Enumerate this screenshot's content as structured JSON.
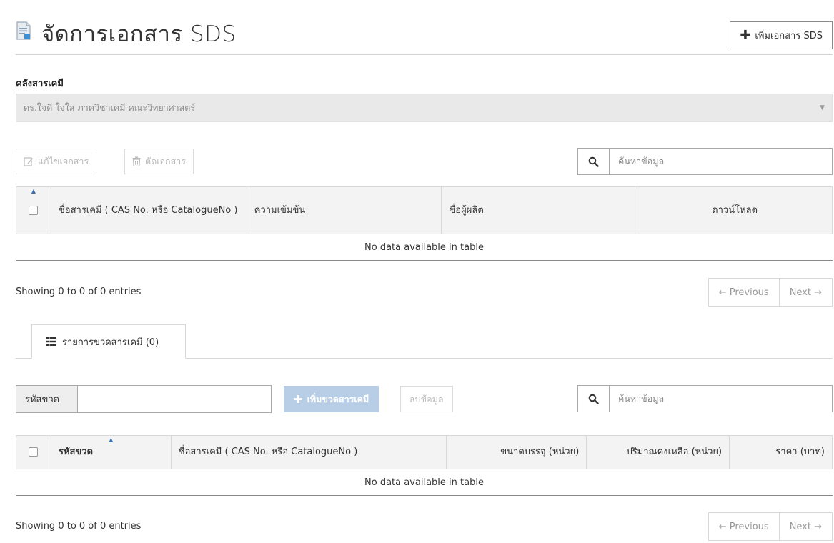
{
  "header": {
    "title": "จัดการเอกสาร SDS",
    "add_button": "เพิ่มเอกสาร SDS"
  },
  "store": {
    "label": "คลังสารเคมี",
    "selected": "ดร.ใจดี ใจใส ภาควิชาเคมี คณะวิทยาศาสตร์"
  },
  "docs_toolbar": {
    "edit_label": "แก้ไขเอกสาร",
    "delete_label": "ตัดเอกสาร",
    "search_placeholder": "ค้นหาข้อมูล"
  },
  "docs_table": {
    "columns": [
      "ชื่อสารเคมี ( CAS No. หรือ CatalogueNo )",
      "ความเข้มข้น",
      "ชื่อผู้ผลิต",
      "ดาวน์โหลด"
    ],
    "empty_text": "No data available in table",
    "info": "Showing 0 to 0 of 0 entries",
    "prev": "← Previous",
    "next": "Next →"
  },
  "tab": {
    "label": "รายการขวดสารเคมี (0)"
  },
  "bottles_toolbar": {
    "code_label": "รหัสขวด",
    "code_value": "",
    "add_label": "เพิ่มขวดสารเคมี",
    "delete_label": "ลบข้อมูล",
    "search_placeholder": "ค้นหาข้อมูล"
  },
  "bottles_table": {
    "columns": [
      "รหัสขวด",
      "ชื่อสารเคมี ( CAS No. หรือ CatalogueNo )",
      "ขนาดบรรจุ (หน่วย)",
      "ปริมาณคงเหลือ (หน่วย)",
      "ราคา (บาท)"
    ],
    "empty_text": "No data available in table",
    "info": "Showing 0 to 0 of 0 entries",
    "prev": "← Previous",
    "next": "Next →"
  },
  "colors": {
    "primary_disabled": "#b7cee6",
    "select_bg": "#e9e9e9",
    "header_bg": "#f3f3f3"
  }
}
